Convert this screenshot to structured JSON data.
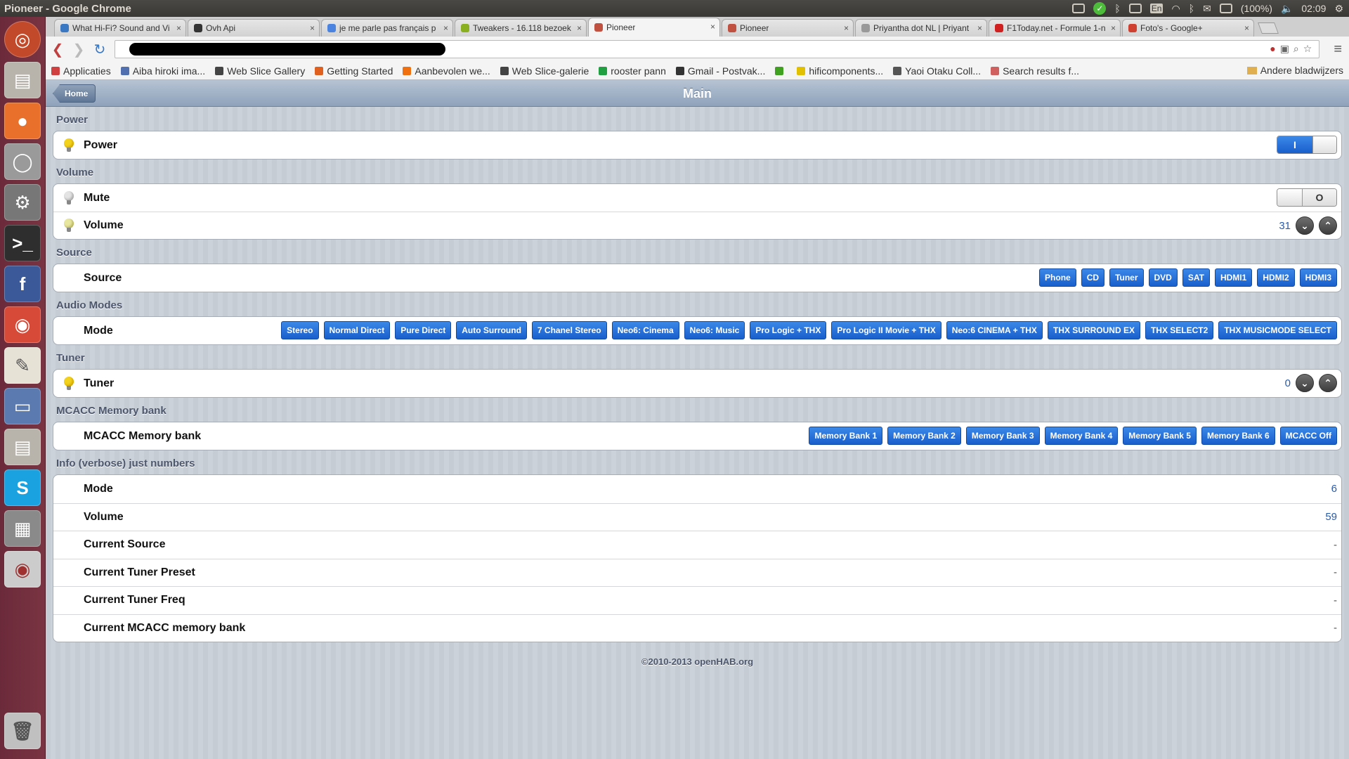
{
  "window": {
    "title": "Pioneer - Google Chrome"
  },
  "tray": {
    "lang": "En",
    "battery": "(100%)",
    "time": "02:09"
  },
  "launcher": [
    "ubuntu-icon",
    "files-icon",
    "firefox-icon",
    "disk-icon",
    "settings-icon",
    "terminal-icon",
    "facebook-icon",
    "chrome-icon",
    "editor-icon",
    "remote-desktop-icon",
    "archive-icon",
    "skype-icon",
    "calculator-icon",
    "dvd-icon",
    "trash-icon"
  ],
  "tabs": [
    {
      "title": "What Hi-Fi? Sound and Vi",
      "color": "#3a78c4"
    },
    {
      "title": "Ovh Api",
      "color": "#333333"
    },
    {
      "title": "je me parle pas français p",
      "color": "#4a84e0"
    },
    {
      "title": "Tweakers - 16.118 bezoek",
      "color": "#8ab020"
    },
    {
      "title": "Pioneer",
      "color": "#c05040"
    },
    {
      "title": "Pioneer",
      "color": "#c05040"
    },
    {
      "title": "Priyantha dot NL | Priyant",
      "color": "#999999"
    },
    {
      "title": "F1Today.net - Formule 1-n",
      "color": "#d02020"
    },
    {
      "title": "Foto's - Google+",
      "color": "#d04030"
    }
  ],
  "bookmarks": [
    {
      "label": "Applicaties",
      "color": "#d04040"
    },
    {
      "label": "Aiba hiroki ima...",
      "color": "#5070b0"
    },
    {
      "label": "Web Slice Gallery",
      "color": "#444444"
    },
    {
      "label": "Getting Started",
      "color": "#e06020"
    },
    {
      "label": "Aanbevolen we...",
      "color": "#f07010"
    },
    {
      "label": "Web Slice-galerie",
      "color": "#444444"
    },
    {
      "label": "rooster pann",
      "color": "#20a040"
    },
    {
      "label": "Gmail - Postvak...",
      "color": "#333333"
    },
    {
      "label": "",
      "color": "#40a020"
    },
    {
      "label": "hificomponents...",
      "color": "#e0c000"
    },
    {
      "label": "Yaoi Otaku Coll...",
      "color": "#555555"
    },
    {
      "label": "Search results f...",
      "color": "#d06060"
    }
  ],
  "bookmarks_other": "Andere bladwijzers",
  "app": {
    "home": "Home",
    "title": "Main",
    "footer": "©2010-2013 openHAB.org"
  },
  "sections": {
    "power": {
      "header": "Power",
      "label": "Power",
      "switch": "I"
    },
    "volume": {
      "header": "Volume",
      "mute_label": "Mute",
      "mute_switch": "O",
      "volume_label": "Volume",
      "volume_value": "31"
    },
    "source": {
      "header": "Source",
      "label": "Source",
      "buttons": [
        "Phone",
        "CD",
        "Tuner",
        "DVD",
        "SAT",
        "HDMI1",
        "HDMI2",
        "HDMI3"
      ]
    },
    "audio": {
      "header": "Audio Modes",
      "label": "Mode",
      "buttons": [
        "Stereo",
        "Normal Direct",
        "Pure Direct",
        "Auto Surround",
        "7 Chanel Stereo",
        "Neo6: Cinema",
        "Neo6: Music",
        "Pro Logic + THX",
        "Pro Logic II Movie + THX",
        "Neo:6 CINEMA + THX",
        "THX SURROUND EX",
        "THX SELECT2",
        "THX MUSICMODE SELECT"
      ]
    },
    "tuner": {
      "header": "Tuner",
      "label": "Tuner",
      "value": "0"
    },
    "mcacc": {
      "header": "MCACC Memory bank",
      "label": "MCACC Memory bank",
      "buttons": [
        "Memory Bank 1",
        "Memory Bank 2",
        "Memory Bank 3",
        "Memory Bank 4",
        "Memory Bank 5",
        "Memory Bank 6",
        "MCACC Off"
      ]
    },
    "info": {
      "header": "Info (verbose) just numbers",
      "rows": [
        {
          "label": "Mode",
          "value": "6"
        },
        {
          "label": "Volume",
          "value": "59"
        },
        {
          "label": "Current Source",
          "value": "-"
        },
        {
          "label": "Current Tuner Preset",
          "value": "-"
        },
        {
          "label": "Current Tuner Freq",
          "value": "-"
        },
        {
          "label": "Current MCACC memory bank",
          "value": "-"
        }
      ]
    }
  },
  "colors": {
    "accent": "#1a5fcc",
    "header_bar": "#8ea2bb",
    "launcher": "#7a3442"
  }
}
